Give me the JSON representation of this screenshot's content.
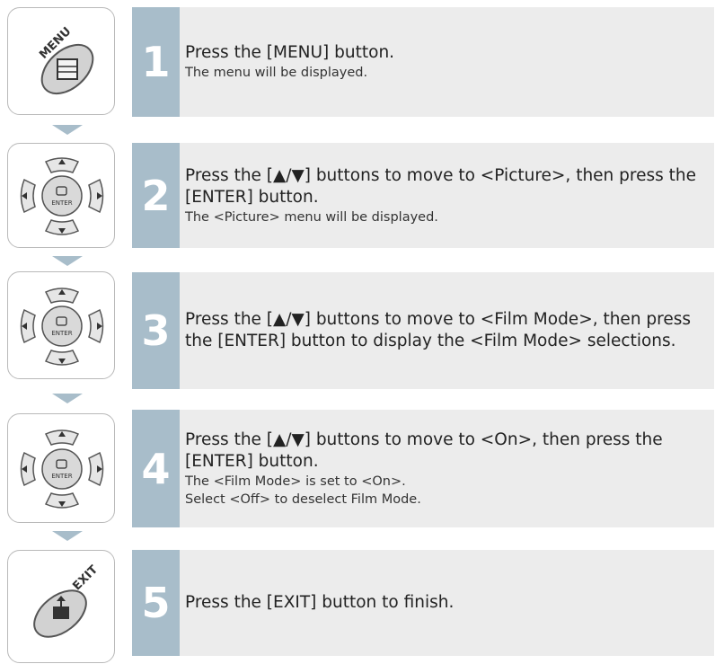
{
  "icons": {
    "menu_label": "MENU",
    "enter_label": "ENTER",
    "exit_label": "EXIT"
  },
  "steps": [
    {
      "number": "1",
      "main": "Press the [MENU] button.",
      "sub": [
        "The menu will be displayed."
      ]
    },
    {
      "number": "2",
      "main": "Press the [▲/▼] buttons to move to <Picture>, then press the [ENTER] button.",
      "sub": [
        "The <Picture> menu will be displayed."
      ]
    },
    {
      "number": "3",
      "main": "Press the [▲/▼] buttons to move to <Film Mode>, then press the [ENTER] button to display the <Film Mode> selections.",
      "sub": []
    },
    {
      "number": "4",
      "main": "Press the [▲/▼] buttons to move to <On>, then press the [ENTER] button.",
      "sub": [
        "The <Film Mode> is set to <On>.",
        "Select <Off> to deselect Film Mode."
      ]
    },
    {
      "number": "5",
      "main": "Press the [EXIT] button to finish.",
      "sub": []
    }
  ],
  "colors": {
    "number_cell": "#a8bdca",
    "step_bg": "#ececec",
    "arrow": "#a8bdca",
    "icon_border": "#b9b9b9"
  }
}
